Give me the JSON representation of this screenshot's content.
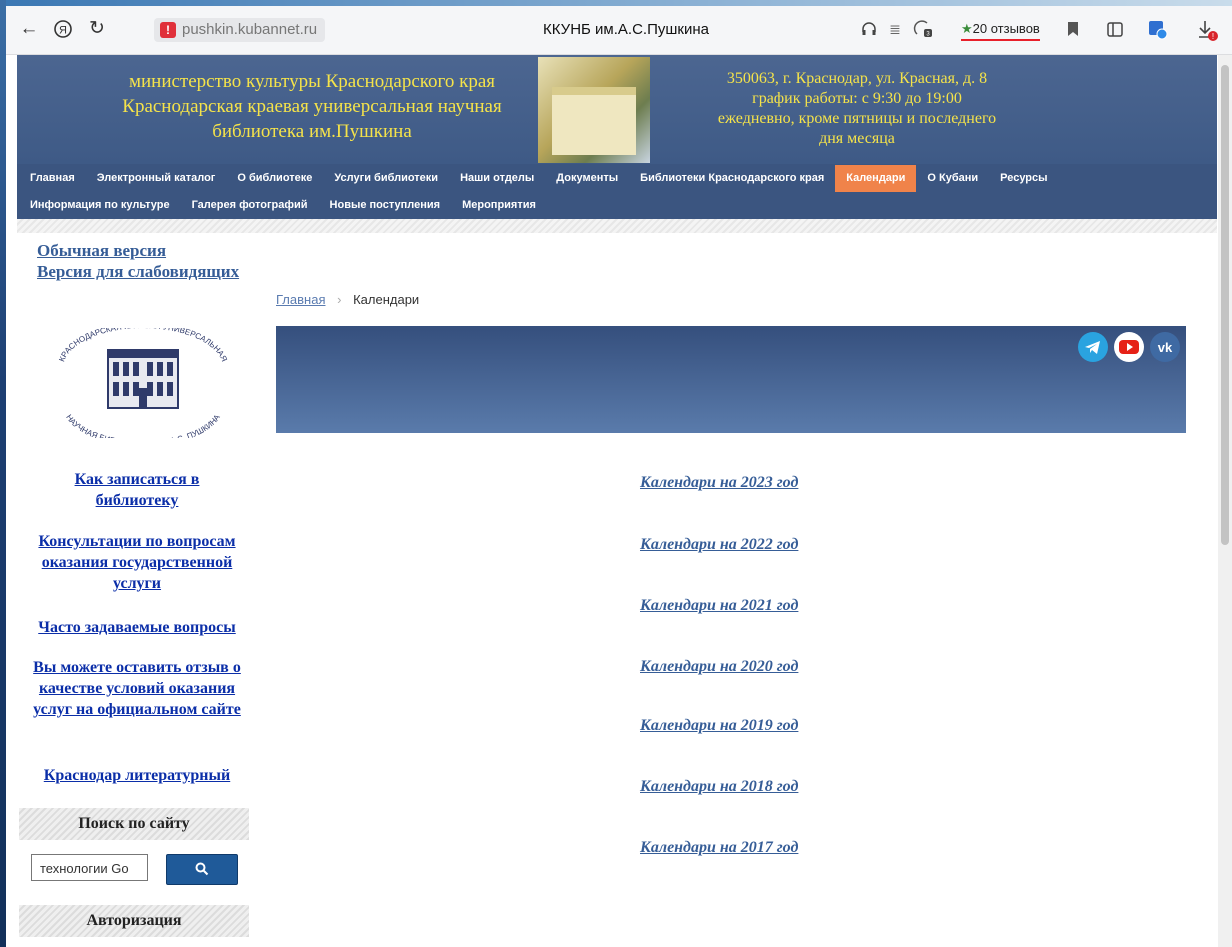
{
  "browser": {
    "address": "pushkin.kubannet.ru",
    "tab_title": "ККУНБ им.А.С.Пушкина",
    "reviews": "20 отзывов"
  },
  "header": {
    "left_lines": [
      "министерство культуры Краснодарского края",
      "Краснодарская краевая универсальная научная",
      "библиотека им.Пушкина"
    ],
    "right_lines": [
      "350063, г. Краснодар, ул. Красная, д. 8",
      "график работы: с 9:30 до 19:00",
      "ежедневно, кроме пятницы и последнего",
      "дня месяца"
    ]
  },
  "nav": {
    "row1": [
      "Главная",
      "Электронный каталог",
      "О библиотеке",
      "Услуги библиотеки",
      "Наши отделы",
      "Документы",
      "Библиотеки Краснодарского края",
      "Календари",
      "О Кубани",
      "Ресурсы"
    ],
    "row2": [
      "Информация по культуре",
      "Галерея фотографий",
      "Новые поступления",
      "Мероприятия"
    ],
    "active": "Календари"
  },
  "sidebar": {
    "version_normal": "Обычная версия",
    "version_low_vision": "Версия для слабовидящих",
    "logo_text_top": "КРАСНОДАРСКАЯ КРАЕВАЯ УНИВЕРСАЛЬНАЯ",
    "logo_text_bottom": "НАУЧНАЯ БИБЛИОТЕКА ИМ. А.С. ПУШКИНА",
    "links": [
      "Как записаться в библиотеку",
      "Консультации по вопросам оказания государственной услуги",
      "Часто задаваемые вопросы",
      "Вы можете оставить отзыв о качестве условий оказания услуг на официальном сайте",
      "Краснодар литературный"
    ],
    "search_title": "Поиск по сайту",
    "search_value": "технологии Go",
    "auth_title": "Авторизация"
  },
  "breadcrumb": {
    "home": "Главная",
    "sep": "›",
    "current": "Календари"
  },
  "calendars": [
    "Календари на 2023 год",
    "Календари на 2022 год",
    "Календари на 2021 год",
    "Календари на 2020 год",
    "Календари на 2019 год",
    "Календари на 2018 год",
    "Календари на 2017 год"
  ],
  "colors": {
    "header_bg": "#4c6691",
    "header_text": "#f5e34a",
    "nav_bg": "#3b5580",
    "nav_active": "#f0834a",
    "link": "#365d97"
  }
}
